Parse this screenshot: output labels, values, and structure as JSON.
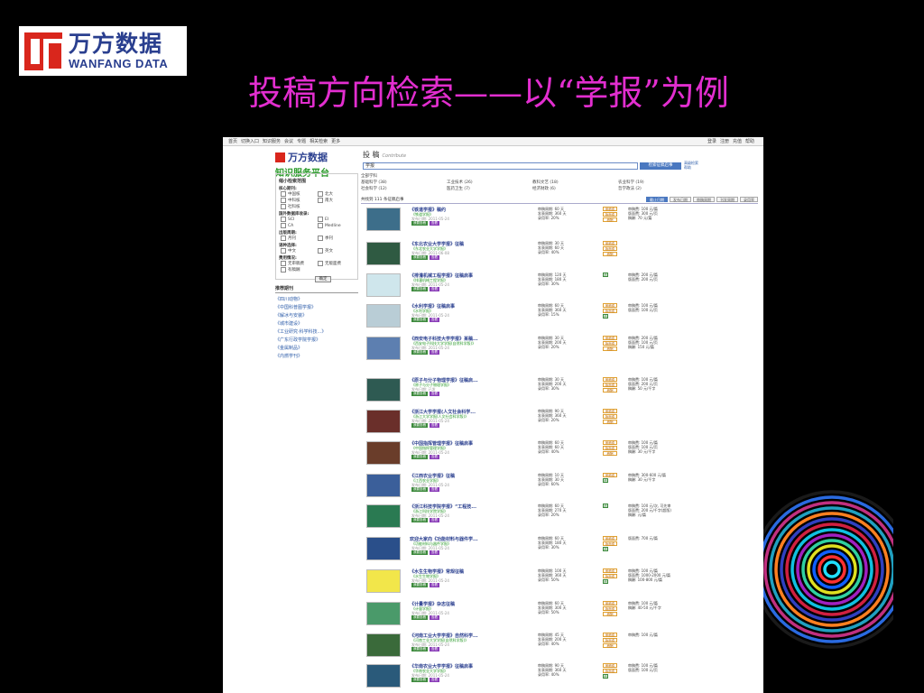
{
  "slide": {
    "logo_cn": "万方数据",
    "logo_en": "WANFANG DATA",
    "title": "投稿方向检索——以“学报”为例"
  },
  "screenshot": {
    "topnav_left": [
      "首页",
      "切换入口",
      "知识服务",
      "会议",
      "专题",
      "相关检索",
      "更多"
    ],
    "topnav_right": [
      "登录",
      "注册",
      "充值",
      "帮助"
    ],
    "site_logo_cn": "万方数据",
    "site_logo_en": "WANFANG DATA",
    "site_slogan": "知识服务平台",
    "search_tab": "投 稿",
    "search_tab_en": "Contribute",
    "search_value": "学报",
    "search_button": "检索征稿启事",
    "search_link_1": "高级检索",
    "search_link_2": "帮助",
    "sidebar": {
      "heading": "缩小检索范围",
      "core_label": "核心期刊:",
      "core_items": [
        "中国核",
        "北大",
        "中科核",
        "南大",
        "社科核"
      ],
      "intl_label": "国外数据库收录:",
      "intl_items": [
        "SCI",
        "EI",
        "CA",
        "Medline"
      ],
      "freq_label": "出版周期:",
      "freq_items": [
        "月刊",
        "季刊"
      ],
      "lang_label": "语种选择:",
      "lang_items": [
        "中文",
        "英文"
      ],
      "fee_label": "费用情况:",
      "fee_items": [
        "无审稿费",
        "无版面费",
        "有稿酬"
      ],
      "confirm": "确定",
      "related_heading": "推荐期刊",
      "related": [
        "《四川动物》",
        "《中国科普图学报》",
        "《解冰与安装》",
        "《城市建设》",
        "《工业研究·科学科技...》",
        "《广东行政学院学报》",
        "《金属制品》",
        "《内燃学刊》"
      ]
    },
    "categories": {
      "title": "全部学科",
      "items": [
        "基础科学 (38)",
        "工业技术 (26)",
        "教科文艺 (18)",
        "农业科学 (19)",
        "社会科学 (12)",
        "医药卫生 (7)",
        "经济财政 (6)",
        "哲学政法 (2)"
      ]
    },
    "result_count": "共找到 111 条征稿启事",
    "sort_buttons": [
      "截止日期",
      "发布日期",
      "审稿周期",
      "刊发周期",
      "录用率"
    ],
    "items": [
      {
        "title": "《铁道学报》稿约",
        "sub": "《铁道学报》",
        "date": "发布日期: 2011-05-24",
        "review": "审稿周期: 60 天",
        "publish": "发表周期: 360 天",
        "accept": "录用率: 20%",
        "tags": [
          "审稿费",
          "版面费",
          "稿酬"
        ],
        "fee1": "审稿费: 100 元/篇",
        "fee2": "版面费: 300 元/页",
        "fee3": "稿酬: 70 元/篇"
      },
      {
        "title": "《东北农业大学学报》征稿",
        "sub": "《东北农业大学学报》",
        "date": "发布日期: 2011-06-08",
        "review": "审稿周期: 30 天",
        "publish": "发表周期: 60 天",
        "accept": "录用率: 40%",
        "tags": [
          "审稿费",
          "版面费",
          "稿酬"
        ],
        "fee1": "",
        "fee2": "",
        "fee3": ""
      },
      {
        "title": "《排灌机械工程学报》征稿启事",
        "sub": "《排灌机械工程学报》",
        "date": "发布日期: 2011-05-24",
        "review": "审稿周期: 120 天",
        "publish": "发表周期: 180 天",
        "accept": "录用率: 30%",
        "tags": [
          "稿"
        ],
        "fee1": "审稿费: 200 元/篇",
        "fee2": "版面费: 200 元/页",
        "fee3": ""
      },
      {
        "title": "《水利学报》征稿启事",
        "sub": "《水利学报》",
        "date": "发布日期: 2011-05-24",
        "review": "审稿周期: 60 天",
        "publish": "发表周期: 360 天",
        "accept": "录用率: 15%",
        "tags": [
          "审稿费",
          "版面费",
          "稿"
        ],
        "fee1": "审稿费: 100 元/篇",
        "fee2": "版面费: 100 元/页",
        "fee3": ""
      },
      {
        "title": "《西安电子科技大学学报》某稿...",
        "sub": "《西安电子科技大学学报(自然科学版)》",
        "date": "发布日期: 2011-05-24",
        "review": "审稿周期: 30 天",
        "publish": "发表周期: 200 天",
        "accept": "录用率: 20%",
        "tags": [
          "审稿费",
          "版面费",
          "稿酬"
        ],
        "fee1": "审稿费: 200 元/篇",
        "fee2": "版面费: 100 元/页",
        "fee3": "稿酬: 150 元/篇"
      },
      {
        "title": "《原子与分子物理学报》征稿启...",
        "sub": "《原子与分子物理学报》",
        "date": "发布日期: 已发",
        "review": "审稿周期: 30 天",
        "publish": "发表周期: 200 天",
        "accept": "录用率: 30%",
        "tags": [
          "审稿费",
          "版面费",
          "稿酬"
        ],
        "fee1": "审稿费: 100 元/篇",
        "fee2": "版面费: 200 元/页",
        "fee3": "稿酬: 50 元/千字"
      },
      {
        "title": "《浙江大学学报(人文社会科学...",
        "sub": "《浙江大学学报(人文社会科学版)》",
        "date": "发布日期: 2011-05-24",
        "review": "审稿周期: 90 天",
        "publish": "发表周期: 360 天",
        "accept": "录用率: 20%",
        "tags": [
          "审稿费",
          "版面费",
          "稿酬"
        ],
        "fee1": "",
        "fee2": "",
        "fee3": ""
      },
      {
        "title": "《中国指挥管理学报》征稿启事",
        "sub": "《中国指挥管理学报》",
        "date": "发布日期: 2011-05-24",
        "review": "审稿周期: 60 天",
        "publish": "发表周期: 60 天",
        "accept": "录用率: 40%",
        "tags": [
          "审稿费",
          "版面费",
          "稿酬"
        ],
        "fee1": "审稿费: 100 元/篇",
        "fee2": "版面费: 100 元/页",
        "fee3": "稿酬: 30 元/千字"
      },
      {
        "title": "《江西农业学报》征稿",
        "sub": "《江西农业学报》",
        "date": "发布日期: 2011-05-24",
        "review": "审稿周期: 10 天",
        "publish": "发表周期: 30 天",
        "accept": "录用率: 60%",
        "tags": [
          "审稿费",
          "稿"
        ],
        "fee1": "审稿费: 300-600 元/篇",
        "fee2": "稿酬: 30 元/千字",
        "fee3": ""
      },
      {
        "title": "《浙江科技学院学报》“工程技...",
        "sub": "《浙江科技学院学报》",
        "date": "发布日期: 2011-05-24",
        "review": "审稿周期: 60 天",
        "publish": "发表周期: 270 天",
        "accept": "录用率: 20%",
        "tags": [
          "稿"
        ],
        "fee1": "审稿费: 100 元/次, 可先审",
        "fee2": "版面费: 200 元/千字(超版)",
        "fee3": "稿酬: 元/篇"
      },
      {
        "title": "欢迎大家向《功能材料与器件学...",
        "sub": "《功能材料与器件学报》",
        "date": "发布日期: 2011-05-24",
        "review": "审稿周期: 60 天",
        "publish": "发表周期: 180 天",
        "accept": "录用率: 30%",
        "tags": [
          "审稿费",
          "版面费",
          "稿"
        ],
        "fee1": "版面费: 700 元/篇",
        "fee2": "",
        "fee3": ""
      },
      {
        "title": "《水生生物学报》常规征稿",
        "sub": "《水生生物学报》",
        "date": "发布日期: 2011-05-24",
        "review": "审稿周期: 100 天",
        "publish": "发表周期: 360 天",
        "accept": "录用率: 50%",
        "tags": [
          "审稿费",
          "版面费",
          "稿"
        ],
        "fee1": "审稿费: 100 元/篇",
        "fee2": "版面费: 1000-2000 元/篇",
        "fee3": "稿酬: 100-800 元/篇"
      },
      {
        "title": "《计量学报》杂志征稿",
        "sub": "《计量学报》",
        "date": "发布日期: 2011-05-24",
        "review": "审稿周期: 60 天",
        "publish": "发表周期: 300 天",
        "accept": "录用率: 50%",
        "tags": [
          "审稿费",
          "版面费",
          "稿酬"
        ],
        "fee1": "审稿费: 100 元/篇",
        "fee2": "稿酬: 40-50 元/千字",
        "fee3": ""
      },
      {
        "title": "《河南工业大学学报》自然科学...",
        "sub": "《河南工业大学学报(自然科学版)》",
        "date": "发布日期: 2011-05-24",
        "review": "审稿周期: 45 天",
        "publish": "发表周期: 200 天",
        "accept": "录用率: 40%",
        "tags": [
          "审稿费",
          "版面费",
          "稿酬"
        ],
        "fee1": "审稿费: 100 元/篇",
        "fee2": "",
        "fee3": ""
      },
      {
        "title": "《华南农业大学学报》征稿启事",
        "sub": "《华南农业大学学报》",
        "date": "发布日期: 2011-05-24",
        "review": "审稿周期: 90 天",
        "publish": "发表周期: 360 天",
        "accept": "录用率: 40%",
        "tags": [
          "审稿费",
          "版面费",
          "稿"
        ],
        "fee1": "审稿费: 100 元/篇",
        "fee2": "版面费: 100 元/页",
        "fee3": ""
      }
    ],
    "submit_label": "我要投稿",
    "detail_label": "查看",
    "cover_colors": [
      "#3d6e8a",
      "#2f5a42",
      "#cfe6ec",
      "#b9cdd6",
      "#5d7fb0",
      "#2e5a52",
      "#6a2f2a",
      "#6a3d2a",
      "#3b5f9a",
      "#2a7a52",
      "#2a4f8a",
      "#f2e64a",
      "#4a9a6a",
      "#3a6a3a",
      "#2a5a7a"
    ]
  }
}
